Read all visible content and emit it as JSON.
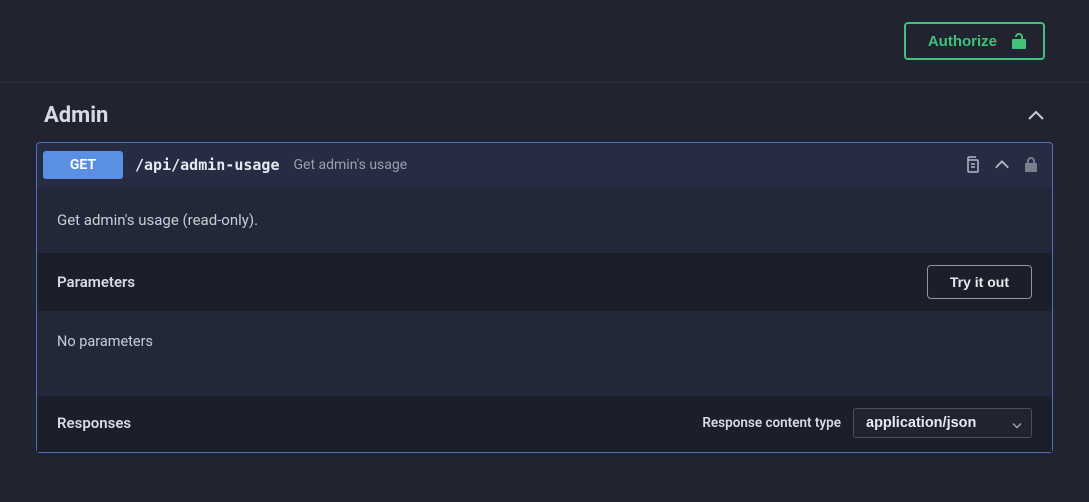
{
  "authorize": {
    "label": "Authorize"
  },
  "section": {
    "title": "Admin"
  },
  "operation": {
    "method": "GET",
    "path": "/api/admin-usage",
    "summary": "Get admin's usage",
    "description": "Get admin's usage (read-only).",
    "parameters_label": "Parameters",
    "try_label": "Try it out",
    "no_params": "No parameters",
    "responses_label": "Responses",
    "rct_label": "Response content type",
    "rct_value": "application/json"
  }
}
